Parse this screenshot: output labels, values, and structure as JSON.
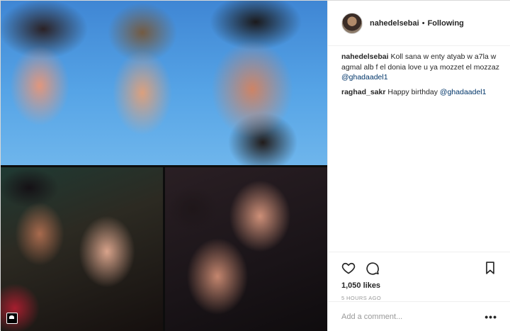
{
  "post": {
    "author": "nahedelsebai",
    "separator": "•",
    "follow_status": "Following",
    "avatar_icon": "user-avatar",
    "comments": [
      {
        "user": "nahedelsebai",
        "text": "Koll sana w enty atyab w a7la w agmal alb f el donia love u ya mozzet el mozzaz ",
        "mention": "@ghadaadel1"
      },
      {
        "user": "raghad_sakr",
        "text": "Happy birthday ",
        "mention": "@ghadaadel1"
      }
    ],
    "likes": "1,050 likes",
    "time": "5 HOURS AGO",
    "comment_placeholder": "Add a comment...",
    "more_label": "•••"
  },
  "icons": {
    "like": "heart-icon",
    "comment": "comment-bubble-icon",
    "save": "bookmark-icon",
    "tagged": "user-tag-icon"
  },
  "colors": {
    "link": "#003569",
    "text": "#262626",
    "muted": "#999999",
    "border": "#efefef"
  }
}
